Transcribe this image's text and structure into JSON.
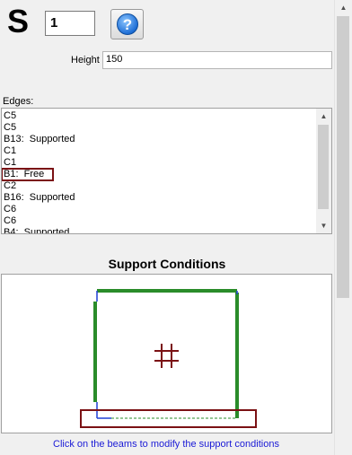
{
  "header": {
    "symbol": "S",
    "slab_number": "1",
    "help_icon": "help-icon",
    "help_glyph": "?"
  },
  "height": {
    "label": "Height",
    "value": "150"
  },
  "edges": {
    "label": "Edges:",
    "items": [
      "C5",
      "C5",
      "B13:  Supported",
      "C1",
      "C1",
      "B1:  Free",
      "C2",
      "B16:  Supported",
      "C6",
      "C6",
      "B4:  Supported"
    ],
    "selected_index": 5
  },
  "support": {
    "title": "Support Conditions",
    "hint": "Click on the beams to modify the support conditions"
  },
  "colors": {
    "supported": "#2a8c2a",
    "free": "#1f3fd6",
    "highlight": "#7b1114",
    "column": "#7b1114"
  }
}
